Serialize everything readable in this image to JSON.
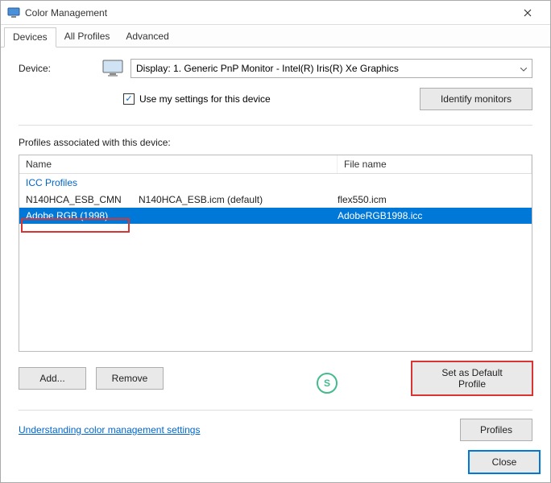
{
  "title": "Color Management",
  "tabs": {
    "devices": "Devices",
    "all": "All Profiles",
    "advanced": "Advanced"
  },
  "device": {
    "label": "Device:",
    "selected": "Display: 1. Generic PnP Monitor - Intel(R) Iris(R) Xe Graphics",
    "use_settings": "Use my settings for this device",
    "identify": "Identify monitors"
  },
  "profiles": {
    "heading": "Profiles associated with this device:",
    "col_name": "Name",
    "col_file": "File name",
    "group": "ICC Profiles",
    "rows": [
      {
        "name": "N140HCA_ESB_CMN",
        "default": "N140HCA_ESB.icm (default)",
        "file": "flex550.icm",
        "selected": false
      },
      {
        "name": "Adobe RGB (1998)",
        "default": "",
        "file": "AdobeRGB1998.icc",
        "selected": true
      }
    ]
  },
  "buttons": {
    "add": "Add...",
    "remove": "Remove",
    "set_default": "Set as Default Profile",
    "profiles": "Profiles",
    "close": "Close"
  },
  "link": "Understanding color management settings",
  "watermark": "S"
}
